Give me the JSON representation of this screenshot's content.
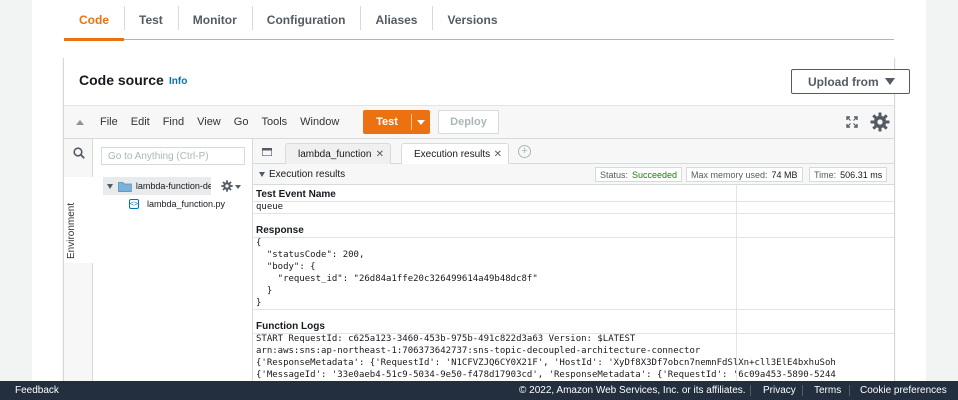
{
  "tabs": [
    {
      "label": "Code",
      "active": true
    },
    {
      "label": "Test"
    },
    {
      "label": "Monitor"
    },
    {
      "label": "Configuration"
    },
    {
      "label": "Aliases"
    },
    {
      "label": "Versions"
    }
  ],
  "code_source": {
    "title": "Code source",
    "info": "Info",
    "upload_label": "Upload from"
  },
  "toolbar": {
    "menu": [
      "File",
      "Edit",
      "Find",
      "View",
      "Go",
      "Tools",
      "Window"
    ],
    "test_label": "Test",
    "deploy_label": "Deploy"
  },
  "sidebar": {
    "goto_placeholder": "Go to Anything (Ctrl-P)",
    "env_label": "Environment",
    "folder_label": "lambda-function-de",
    "file_label": "lambda_function.py"
  },
  "editor_tabs": [
    {
      "label": "lambda_function"
    },
    {
      "label": "Execution results"
    }
  ],
  "results": {
    "header": "Execution results",
    "status_label": "Status:",
    "status_value": "Succeeded",
    "memory_label": "Max memory used:",
    "memory_value": "74 MB",
    "time_label": "Time:",
    "time_value": "506.31 ms",
    "event_heading": "Test Event Name",
    "event_name": "queue",
    "response_heading": "Response",
    "response_lines": [
      "{",
      "  \"statusCode\": 200,",
      "  \"body\": {",
      "    \"request_id\": \"26d84a1ffe20c326499614a49b48dc8f\"",
      "  }",
      "}"
    ],
    "logs_heading": "Function Logs",
    "log_lines": [
      "START RequestId: c625a123-3460-453b-975b-491c822d3a63 Version: $LATEST",
      "arn:aws:sns:ap-northeast-1:706373642737:sns-topic-decoupled-architecture-connector",
      "{'ResponseMetadata': {'RequestId': 'N1CFVZJQ6CY0X21F', 'HostId': 'XyDf8X3Df7obcn7nemnFdSlXn+cll3ElE4bxhuSoh",
      "{'MessageId': '33e0aeb4-51c9-5034-9e50-f478d17903cd', 'ResponseMetadata': {'RequestId': '6c09a453-5890-5244"
    ],
    "status_color": "#1d8102"
  },
  "footer": {
    "feedback": "Feedback",
    "copyright": "© 2022, Amazon Web Services, Inc. or its affiliates.",
    "privacy": "Privacy",
    "terms": "Terms",
    "cookies": "Cookie preferences"
  },
  "colors": {
    "accent": "#ec7211",
    "link": "#0073bb",
    "footer_bg": "#232f3e"
  }
}
